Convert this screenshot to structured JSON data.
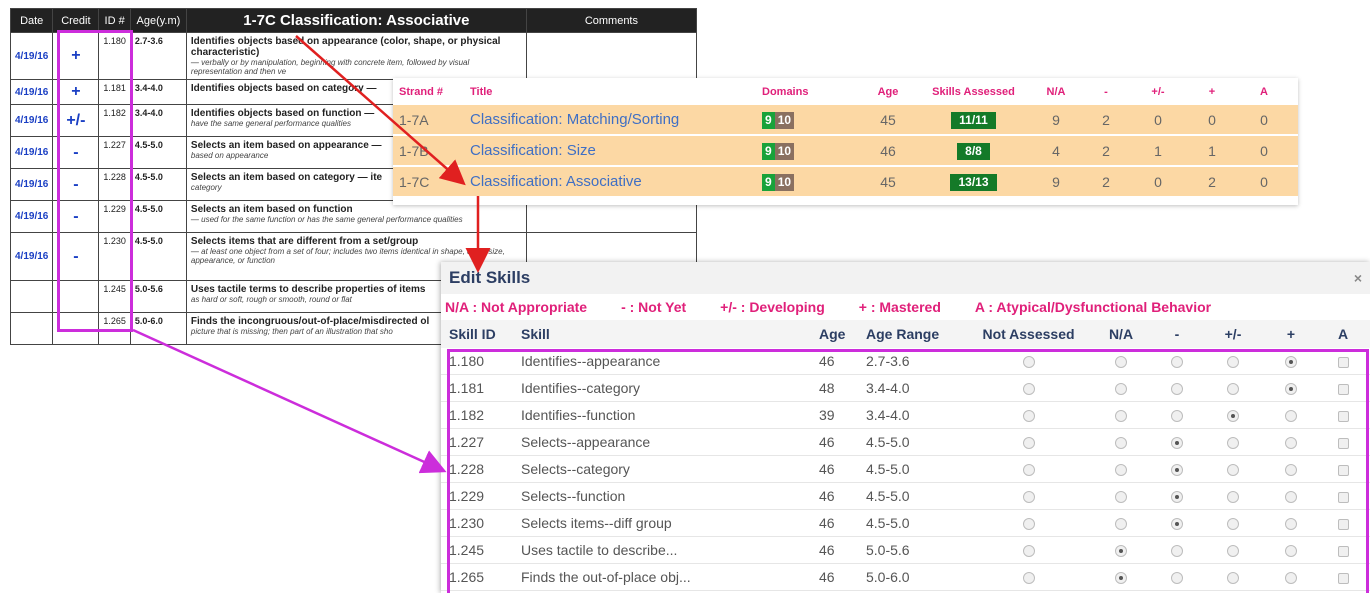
{
  "paper": {
    "headers": [
      "Date",
      "Credit",
      "ID #",
      "Age(y.m)",
      "1-7C Classification: Associative",
      "Comments"
    ],
    "rows": [
      {
        "date": "4/19/16",
        "credit": "+",
        "id": "1.180",
        "age": "2.7-3.6",
        "desc": "Identifies objects based on appearance (color, shape, or physical characteristic)",
        "sub": "— verbally or by manipulation, beginning with concrete item, followed by visual representation and then ve",
        "cls": "r-tall"
      },
      {
        "date": "4/19/16",
        "credit": "+",
        "id": "1.181",
        "age": "3.4-4.0",
        "desc": "Identifies objects based on category —",
        "sub": "",
        "cls": "r-short"
      },
      {
        "date": "4/19/16",
        "credit": "+/-",
        "id": "1.182",
        "age": "3.4-4.0",
        "desc": "Identifies objects based on function —",
        "sub": "have the same general performance qualities",
        "cls": "r-med"
      },
      {
        "date": "4/19/16",
        "credit": "-",
        "id": "1.227",
        "age": "4.5-5.0",
        "desc": "Selects an item based on appearance —",
        "sub": "based on appearance",
        "cls": "r-med"
      },
      {
        "date": "4/19/16",
        "credit": "-",
        "id": "1.228",
        "age": "4.5-5.0",
        "desc": "Selects an item based on category — ite",
        "sub": "category",
        "cls": "r-med"
      },
      {
        "date": "4/19/16",
        "credit": "-",
        "id": "1.229",
        "age": "4.5-5.0",
        "desc": "Selects an item based on function",
        "sub": "— used for the same function or has the same general performance qualities",
        "cls": "r-med"
      },
      {
        "date": "4/19/16",
        "credit": "-",
        "id": "1.230",
        "age": "4.5-5.0",
        "desc": "Selects items that are different from a set/group",
        "sub": "— at least one object from a set of four; includes two items identical in shape, color, size, appearance, or function",
        "cls": "r-big"
      },
      {
        "date": "",
        "credit": "",
        "id": "1.245",
        "age": "5.0-5.6",
        "desc": "Uses tactile terms to describe properties of items",
        "sub": "as hard or soft, rough or smooth, round or flat",
        "cls": "r-med"
      },
      {
        "date": "",
        "credit": "",
        "id": "1.265",
        "age": "5.0-6.0",
        "desc": "Finds the incongruous/out-of-place/misdirected ol",
        "sub": "picture that is missing; then part of an illustration that sho",
        "cls": "r-med"
      }
    ]
  },
  "strand": {
    "headers": [
      "Strand #",
      "Title",
      "Domains",
      "Age",
      "Skills Assessed",
      "N/A",
      "-",
      "+/-",
      "+",
      "A"
    ],
    "rows": [
      {
        "strand": "1-7A",
        "title": "Classification: Matching/Sorting",
        "d1": "9",
        "d2": "10",
        "age": "45",
        "skills": "11/11",
        "na": "9",
        "minus": "2",
        "pm": "0",
        "plus": "0",
        "a": "0"
      },
      {
        "strand": "1-7B",
        "title": "Classification: Size",
        "d1": "9",
        "d2": "10",
        "age": "46",
        "skills": "8/8",
        "na": "4",
        "minus": "2",
        "pm": "1",
        "plus": "1",
        "a": "0"
      },
      {
        "strand": "1-7C",
        "title": "Classification: Associative",
        "d1": "9",
        "d2": "10",
        "age": "45",
        "skills": "13/13",
        "na": "9",
        "minus": "2",
        "pm": "0",
        "plus": "2",
        "a": "0"
      }
    ]
  },
  "edit": {
    "title": "Edit Skills",
    "close": "×",
    "legend": [
      "N/A : Not Appropriate",
      "- : Not Yet",
      "+/- : Developing",
      "+ : Mastered",
      "A : Atypical/Dysfunctional Behavior"
    ],
    "headers": [
      "Skill ID",
      "Skill",
      "Age",
      "Age Range",
      "Not Assessed",
      "N/A",
      "-",
      "+/-",
      "+",
      "A"
    ],
    "rows": [
      {
        "id": "1.180",
        "skill": "Identifies--appearance",
        "age": "46",
        "range": "2.7-3.6",
        "sel": 4
      },
      {
        "id": "1.181",
        "skill": "Identifies--category",
        "age": "48",
        "range": "3.4-4.0",
        "sel": 4
      },
      {
        "id": "1.182",
        "skill": "Identifies--function",
        "age": "39",
        "range": "3.4-4.0",
        "sel": 3
      },
      {
        "id": "1.227",
        "skill": "Selects--appearance",
        "age": "46",
        "range": "4.5-5.0",
        "sel": 2
      },
      {
        "id": "1.228",
        "skill": "Selects--category",
        "age": "46",
        "range": "4.5-5.0",
        "sel": 2
      },
      {
        "id": "1.229",
        "skill": "Selects--function",
        "age": "46",
        "range": "4.5-5.0",
        "sel": 2
      },
      {
        "id": "1.230",
        "skill": "Selects items--diff group",
        "age": "46",
        "range": "4.5-5.0",
        "sel": 2
      },
      {
        "id": "1.245",
        "skill": "Uses tactile to describe...",
        "age": "46",
        "range": "5.0-5.6",
        "sel": 1
      },
      {
        "id": "1.265",
        "skill": "Finds the out-of-place obj...",
        "age": "46",
        "range": "5.0-6.0",
        "sel": 1
      }
    ]
  },
  "colors": {
    "accent": "#e0207a",
    "highlight": "#cc2ddb",
    "row": "#fcd8a4",
    "link": "#3f6fc4",
    "arrow": "#e02020"
  }
}
